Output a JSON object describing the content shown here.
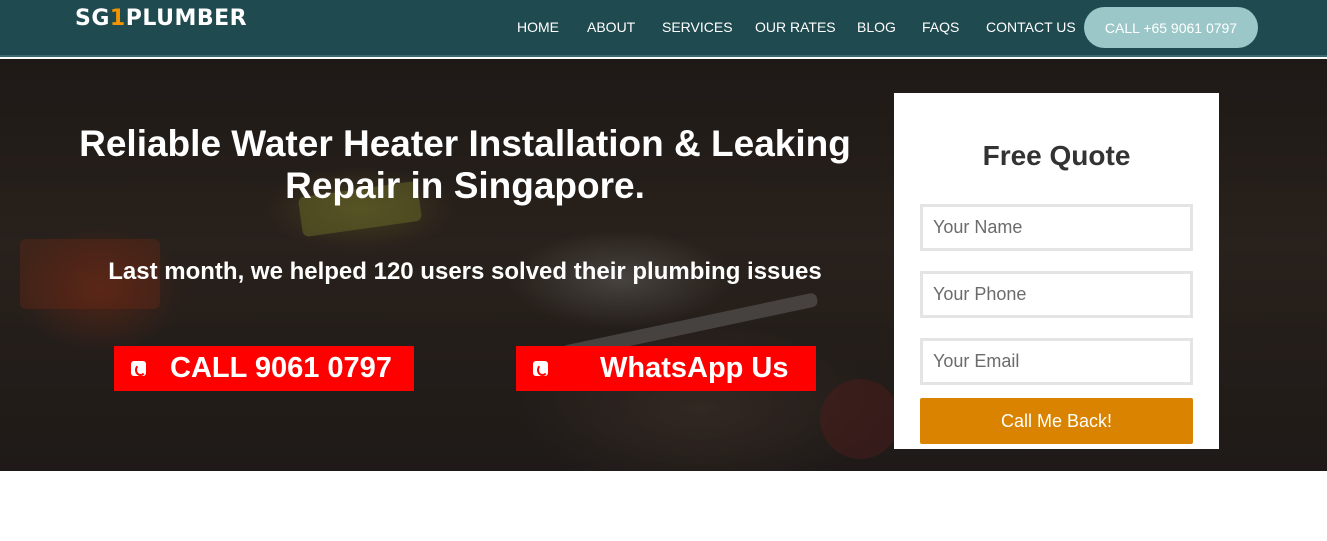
{
  "header": {
    "logo": {
      "prefix": "SG",
      "highlight": "1",
      "suffix": "PLUMBER"
    },
    "nav": [
      "HOME",
      "ABOUT",
      "SERVICES",
      "OUR RATES",
      "BLOG",
      "FAQS",
      "CONTACT US"
    ],
    "call_button": "CALL +65 9061 0797"
  },
  "hero": {
    "title": "Reliable Water Heater Installation & Leaking Repair in Singapore.",
    "subtitle": "Last month, we helped 120 users solved their plumbing issues",
    "cta_call": "CALL 9061 0797",
    "cta_whatsapp": "WhatsApp Us"
  },
  "quote_form": {
    "title": "Free Quote",
    "name_placeholder": "Your Name",
    "phone_placeholder": "Your Phone",
    "email_placeholder": "Your Email",
    "submit_label": "Call Me Back!"
  },
  "colors": {
    "header_bg": "#1f4a4f",
    "logo_accent": "#f29400",
    "call_pill": "#9cc7c8",
    "cta_red": "#ff0000",
    "submit_orange": "#d98300"
  },
  "icons": [
    "phone-icon",
    "whatsapp-icon"
  ]
}
